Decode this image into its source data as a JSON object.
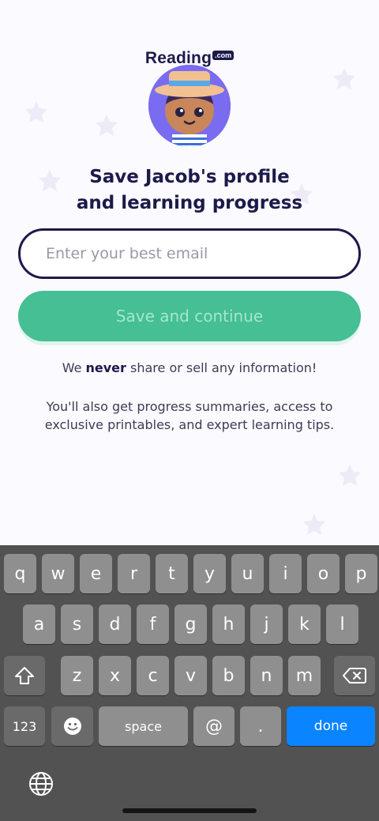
{
  "logo": {
    "name": "Reading",
    "suffix": ".com"
  },
  "title": {
    "line1": "Save Jacob's profile",
    "line2": "and learning progress"
  },
  "email": {
    "placeholder": "Enter your best email",
    "value": ""
  },
  "save_button": {
    "label": "Save and continue"
  },
  "privacy": {
    "prefix": "We ",
    "emphasis": "never",
    "suffix": " share or sell any information!"
  },
  "benefits": {
    "line1": "You'll also get progress summaries, access to",
    "line2": "exclusive printables, and expert learning tips."
  },
  "colors": {
    "accent": "#45bf93",
    "text": "#1c1a4a",
    "done": "#0a84ff"
  },
  "keyboard": {
    "row1": [
      "q",
      "w",
      "e",
      "r",
      "t",
      "y",
      "u",
      "i",
      "o",
      "p"
    ],
    "row2": [
      "a",
      "s",
      "d",
      "f",
      "g",
      "h",
      "j",
      "k",
      "l"
    ],
    "row3": [
      "z",
      "x",
      "c",
      "v",
      "b",
      "n",
      "m"
    ],
    "numbers_label": "123",
    "space_label": "space",
    "at_label": "@",
    "dot_label": ".",
    "done_label": "done",
    "icons": [
      "shift-icon",
      "backspace-icon",
      "emoji-icon",
      "globe-icon"
    ]
  }
}
